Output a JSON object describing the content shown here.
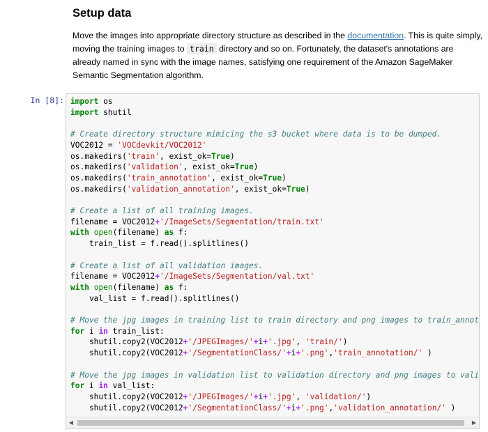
{
  "markdown": {
    "title": "Setup data",
    "para_before_link": "Move the images into appropriate directory structure as described in the ",
    "link_text": "documentation",
    "para_after_link": ". This is quite simply, moving the training images to ",
    "inline_code": "train",
    "para_rest": " directory and so on. Fortunately, the dataset's annotations are already named in sync with the image names, satisfying one requirement of the Amazon SageMaker Semantic Segmentation algorithm."
  },
  "cell": {
    "prompt": "In [8]:",
    "lines": [
      [
        [
          "kw",
          "import"
        ],
        [
          "t",
          " os"
        ]
      ],
      [
        [
          "kw",
          "import"
        ],
        [
          "t",
          " shutil"
        ]
      ],
      [],
      [
        [
          "com",
          "# Create directory structure mimicing the s3 bucket where data is to be dumped."
        ]
      ],
      [
        [
          "t",
          "VOC2012 = "
        ],
        [
          "str",
          "'VOCdevkit/VOC2012'"
        ]
      ],
      [
        [
          "t",
          "os.makedirs("
        ],
        [
          "str",
          "'train'"
        ],
        [
          "t",
          ", exist_ok="
        ],
        [
          "kw",
          "True"
        ],
        [
          "t",
          ")"
        ]
      ],
      [
        [
          "t",
          "os.makedirs("
        ],
        [
          "str",
          "'validation'"
        ],
        [
          "t",
          ", exist_ok="
        ],
        [
          "kw",
          "True"
        ],
        [
          "t",
          ")"
        ]
      ],
      [
        [
          "t",
          "os.makedirs("
        ],
        [
          "str",
          "'train_annotation'"
        ],
        [
          "t",
          ", exist_ok="
        ],
        [
          "kw",
          "True"
        ],
        [
          "t",
          ")"
        ]
      ],
      [
        [
          "t",
          "os.makedirs("
        ],
        [
          "str",
          "'validation_annotation'"
        ],
        [
          "t",
          ", exist_ok="
        ],
        [
          "kw",
          "True"
        ],
        [
          "t",
          ")"
        ]
      ],
      [],
      [
        [
          "com",
          "# Create a list of all training images."
        ]
      ],
      [
        [
          "t",
          "filename = VOC2012"
        ],
        [
          "op",
          "+"
        ],
        [
          "str",
          "'/ImageSets/Segmentation/train.txt'"
        ]
      ],
      [
        [
          "kw",
          "with"
        ],
        [
          "t",
          " "
        ],
        [
          "bi",
          "open"
        ],
        [
          "t",
          "(filename) "
        ],
        [
          "kw",
          "as"
        ],
        [
          "t",
          " f:"
        ]
      ],
      [
        [
          "t",
          "    train_list = f.read().splitlines()"
        ]
      ],
      [],
      [
        [
          "com",
          "# Create a list of all validation images."
        ]
      ],
      [
        [
          "t",
          "filename = VOC2012"
        ],
        [
          "op",
          "+"
        ],
        [
          "str",
          "'/ImageSets/Segmentation/val.txt'"
        ]
      ],
      [
        [
          "kw",
          "with"
        ],
        [
          "t",
          " "
        ],
        [
          "bi",
          "open"
        ],
        [
          "t",
          "(filename) "
        ],
        [
          "kw",
          "as"
        ],
        [
          "t",
          " f:"
        ]
      ],
      [
        [
          "t",
          "    val_list = f.read().splitlines()"
        ]
      ],
      [],
      [
        [
          "com",
          "# Move the jpg images in training list to train directory and png images to train_annotatio"
        ]
      ],
      [
        [
          "kw",
          "for"
        ],
        [
          "t",
          " i "
        ],
        [
          "op",
          "in"
        ],
        [
          "t",
          " train_list:"
        ]
      ],
      [
        [
          "t",
          "    shutil.copy2(VOC2012"
        ],
        [
          "op",
          "+"
        ],
        [
          "str",
          "'/JPEGImages/'"
        ],
        [
          "op",
          "+"
        ],
        [
          "t",
          "i"
        ],
        [
          "op",
          "+"
        ],
        [
          "str",
          "'.jpg'"
        ],
        [
          "t",
          ", "
        ],
        [
          "str",
          "'train/'"
        ],
        [
          "t",
          ")"
        ]
      ],
      [
        [
          "t",
          "    shutil.copy2(VOC2012"
        ],
        [
          "op",
          "+"
        ],
        [
          "str",
          "'/SegmentationClass/'"
        ],
        [
          "op",
          "+"
        ],
        [
          "t",
          "i"
        ],
        [
          "op",
          "+"
        ],
        [
          "str",
          "'.png'"
        ],
        [
          "t",
          ","
        ],
        [
          "str",
          "'train_annotation/'"
        ],
        [
          "t",
          " )"
        ]
      ],
      [],
      [
        [
          "com",
          "# Move the jpg images in validation list to validation directory and png images to validati"
        ]
      ],
      [
        [
          "kw",
          "for"
        ],
        [
          "t",
          " i "
        ],
        [
          "op",
          "in"
        ],
        [
          "t",
          " val_list:"
        ]
      ],
      [
        [
          "t",
          "    shutil.copy2(VOC2012"
        ],
        [
          "op",
          "+"
        ],
        [
          "str",
          "'/JPEGImages/'"
        ],
        [
          "op",
          "+"
        ],
        [
          "t",
          "i"
        ],
        [
          "op",
          "+"
        ],
        [
          "str",
          "'.jpg'"
        ],
        [
          "t",
          ", "
        ],
        [
          "str",
          "'validation/'"
        ],
        [
          "t",
          ")"
        ]
      ],
      [
        [
          "t",
          "    shutil.copy2(VOC2012"
        ],
        [
          "op",
          "+"
        ],
        [
          "str",
          "'/SegmentationClass/'"
        ],
        [
          "op",
          "+"
        ],
        [
          "t",
          "i"
        ],
        [
          "op",
          "+"
        ],
        [
          "str",
          "'.png'"
        ],
        [
          "t",
          ","
        ],
        [
          "str",
          "'validation_annotation/'"
        ],
        [
          "t",
          " )"
        ]
      ]
    ]
  },
  "scrollbar": {
    "left_arrow": "◀",
    "right_arrow": "▶"
  }
}
